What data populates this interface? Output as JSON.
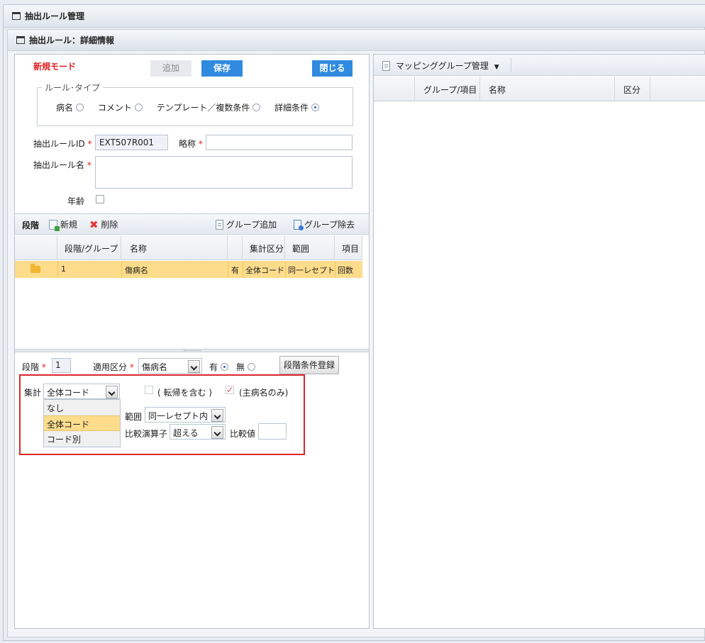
{
  "window": {
    "title": "抽出ルール管理"
  },
  "detail": {
    "title": "抽出ルール：詳細情報"
  },
  "form": {
    "mode": "新規モード",
    "add_label": "追加",
    "save_label": "保存",
    "close_label": "閉じる",
    "rule_type_legend": "ルール･タイプ",
    "rule_types": [
      {
        "label": "病名",
        "selected": false
      },
      {
        "label": "コメント",
        "selected": false
      },
      {
        "label": "テンプレート／複数条件",
        "selected": false
      },
      {
        "label": "詳細条件",
        "selected": true
      }
    ],
    "rule_id_label": "抽出ルールID",
    "rule_id_value": "EXT507R001",
    "abbrev_label": "略称",
    "abbrev_value": "",
    "rule_name_label": "抽出ルール名",
    "rule_name_value": "",
    "age_label": "年齢",
    "required_mark": "*"
  },
  "stage_toolbar": {
    "title": "段階",
    "new_label": "新規",
    "delete_label": "削除",
    "group_add_label": "グループ追加",
    "group_remove_label": "グループ除去"
  },
  "stage_grid": {
    "columns": [
      "段階/グループ",
      "名称",
      "",
      "集計区分",
      "範囲",
      "項目"
    ],
    "rows": [
      {
        "stage": "1",
        "name": "傷病名",
        "flag": "有",
        "agg": "全体コード",
        "range": "同一レセプト",
        "item": "回数"
      }
    ]
  },
  "stage_form": {
    "stage_label": "段階",
    "stage_value": "1",
    "apply_label": "適用区分",
    "apply_value": "傷病名",
    "yes_label": "有",
    "no_label": "無",
    "register_label": "段階条件登録",
    "agg_label": "集計",
    "agg_value": "全体コード",
    "agg_options": [
      "なし",
      "全体コード",
      "コード別"
    ],
    "agg_selected_index": 1,
    "transfer_label": "( 転帰を含む )",
    "main_only_label": "(主病名のみ)",
    "range_label": "範囲",
    "range_value": "同一レセプト内",
    "op_label": "比較演算子",
    "op_value": "超える",
    "compare_label": "比較値",
    "compare_value": ""
  },
  "mapping": {
    "menu_label": "マッピンググループ管理",
    "columns": [
      "グループ/項目",
      "名称",
      "区分"
    ]
  },
  "colors": {
    "accent_blue": "#2f8ae0",
    "highlight_red": "#e02020",
    "selected_row": "#fddc8c"
  }
}
